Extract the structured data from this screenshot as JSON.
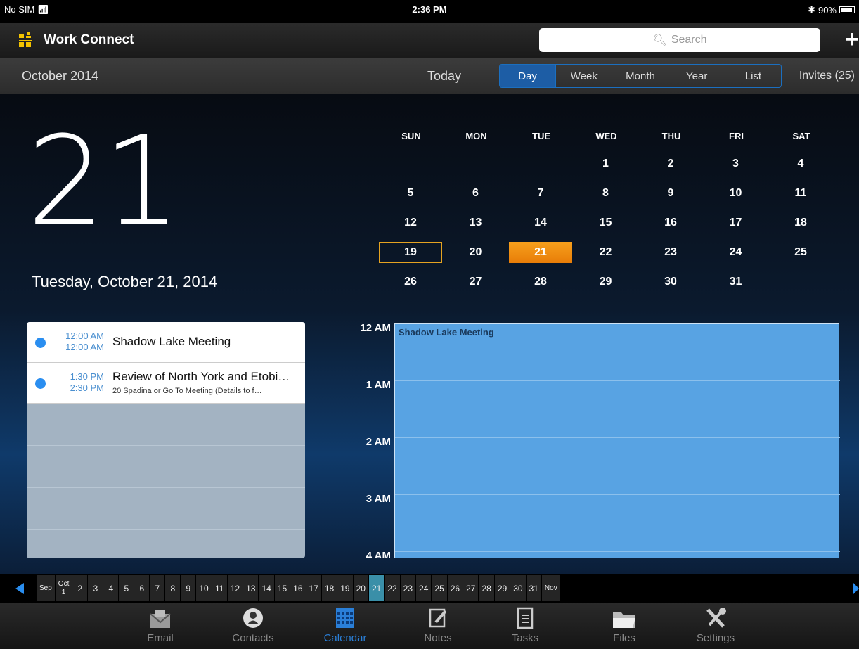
{
  "status": {
    "carrier": "No SIM",
    "time": "2:36 PM",
    "battery": "90%",
    "battery_level": 0.9
  },
  "app": {
    "title": "Work Connect",
    "search_placeholder": "Search",
    "add": "+"
  },
  "toolbar": {
    "month": "October 2014",
    "today": "Today",
    "views": [
      "Day",
      "Week",
      "Month",
      "Year",
      "List"
    ],
    "active_view": "Day",
    "invites": "Invites (25)"
  },
  "selected": {
    "day_number": "21",
    "long_date": "Tuesday, October 21, 2014"
  },
  "events": [
    {
      "start": "12:00 AM",
      "end": "12:00 AM",
      "title": "Shadow Lake Meeting",
      "subtitle": ""
    },
    {
      "start": "1:30 PM",
      "end": "2:30 PM",
      "title": "Review of North York and Etobi…",
      "subtitle": "20 Spadina or Go To Meeting (Details to f…"
    }
  ],
  "minical": {
    "headers": [
      "SUN",
      "MON",
      "TUE",
      "WED",
      "THU",
      "FRI",
      "SAT"
    ],
    "weeks": [
      [
        "",
        "",
        "",
        "1",
        "2",
        "3",
        "4"
      ],
      [
        "5",
        "6",
        "7",
        "8",
        "9",
        "10",
        "11"
      ],
      [
        "12",
        "13",
        "14",
        "15",
        "16",
        "17",
        "18"
      ],
      [
        "19",
        "20",
        "21",
        "22",
        "23",
        "24",
        "25"
      ],
      [
        "26",
        "27",
        "28",
        "29",
        "30",
        "31",
        ""
      ]
    ],
    "today": "21",
    "outlined": "19"
  },
  "dayview": {
    "hours": [
      "12 AM",
      "1 AM",
      "2 AM",
      "3 AM",
      "4 AM"
    ],
    "event_title": "Shadow Lake Meeting"
  },
  "strip": {
    "items": [
      "Sep",
      "Oct|1",
      "2",
      "3",
      "4",
      "5",
      "6",
      "7",
      "8",
      "9",
      "10",
      "11",
      "12",
      "13",
      "14",
      "15",
      "16",
      "17",
      "18",
      "19",
      "20",
      "21",
      "22",
      "23",
      "24",
      "25",
      "26",
      "27",
      "28",
      "29",
      "30",
      "31",
      "Nov"
    ],
    "current": "21"
  },
  "tabs": [
    {
      "label": "Email",
      "icon": "envelope-icon"
    },
    {
      "label": "Contacts",
      "icon": "person-icon"
    },
    {
      "label": "Calendar",
      "icon": "calendar-icon"
    },
    {
      "label": "Notes",
      "icon": "note-edit-icon"
    },
    {
      "label": "Tasks",
      "icon": "checklist-icon"
    },
    {
      "label": "Files",
      "icon": "folder-icon"
    },
    {
      "label": "Settings",
      "icon": "tools-icon"
    }
  ],
  "active_tab": "Calendar",
  "colors": {
    "accent": "#2a8ef0",
    "today": "#f18a10",
    "event_block": "#58a3e3",
    "active_seg": "#1d5da5"
  }
}
